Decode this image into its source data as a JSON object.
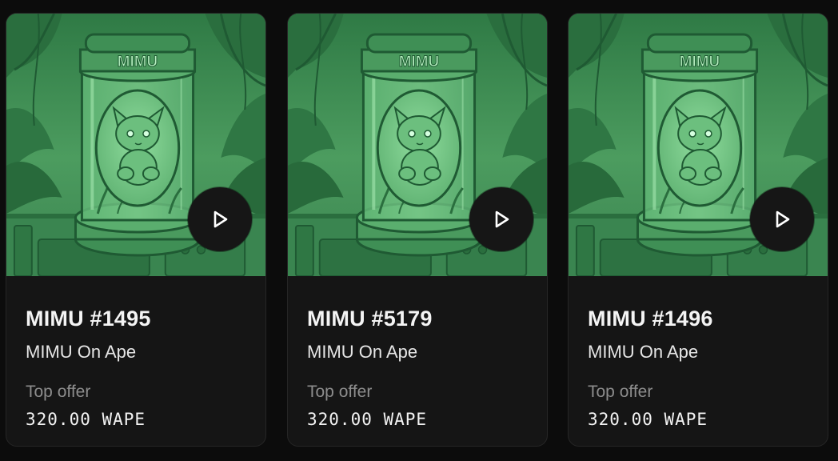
{
  "cards": [
    {
      "pod_label": "MIMU",
      "name": "MIMU #1495",
      "collection": "MIMU On Ape",
      "offer_label": "Top offer",
      "offer_value": "320.00 WAPE"
    },
    {
      "pod_label": "MIMU",
      "name": "MIMU #5179",
      "collection": "MIMU On Ape",
      "offer_label": "Top offer",
      "offer_value": "320.00 WAPE"
    },
    {
      "pod_label": "MIMU",
      "name": "MIMU #1496",
      "collection": "MIMU On Ape",
      "offer_label": "Top offer",
      "offer_value": "320.00 WAPE"
    }
  ],
  "colors": {
    "page_background": "#0c0c0c",
    "card_background": "#151515",
    "art_green": "#4a9a5e",
    "art_dark_green": "#1f5a33",
    "label_gray": "#8d8d8d",
    "play_button": "#161616"
  },
  "icons": {
    "play": "play-icon"
  }
}
